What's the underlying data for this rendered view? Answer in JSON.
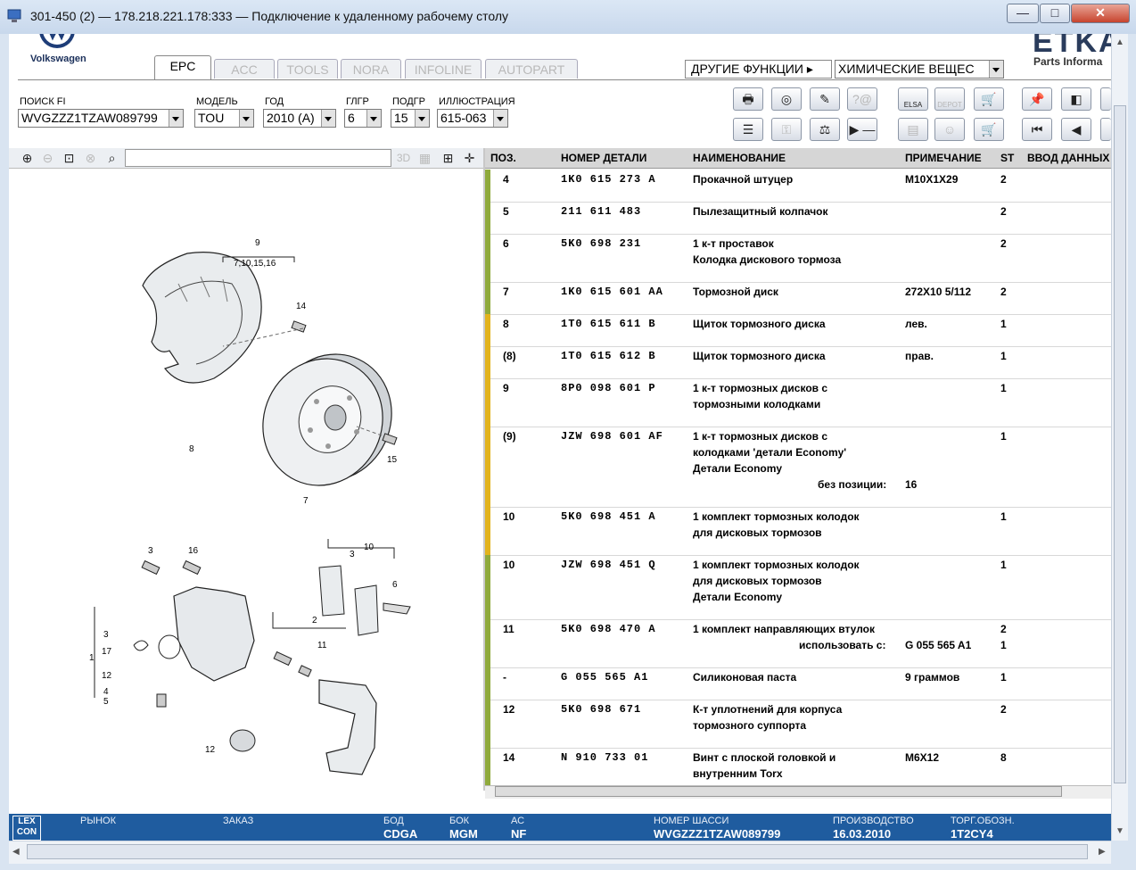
{
  "window": {
    "title": "301-450 (2) — 178.218.221.178:333 — Подключение к удаленному рабочему столу",
    "minimize": "—",
    "maximize": "□",
    "close": "✕"
  },
  "header": {
    "brand": "Volkswagen",
    "etka_logo": "ETKA",
    "etka_sub": "Parts Informa",
    "tabs": [
      "EPC",
      "ACC",
      "TOOLS",
      "NORA",
      "INFOLINE",
      "AUTOPART"
    ],
    "other_functions": "ДРУГИЕ ФУНКЦИИ ▸",
    "chem_combo": "ХИМИЧЕСКИЕ ВЕЩЕС"
  },
  "search": {
    "fi_label": "ПОИСК FI",
    "fi_value": "WVGZZZ1TZAW089799",
    "model_label": "МОДЕЛЬ",
    "model_value": "TOU",
    "year_label": "ГОД",
    "year_value": "2010 (A)",
    "group_label": "ГЛГР",
    "group_value": "6",
    "subgroup_label": "ПОДГР",
    "subgroup_value": "15",
    "illustration_label": "ИЛЛЮСТРАЦИЯ",
    "illustration_value": "615-063"
  },
  "toolbar": {
    "elsa": "ELSA",
    "depot": "DEPOT",
    "threed": "3D"
  },
  "table": {
    "headers": {
      "pos": "ПОЗ.",
      "part": "НОМЕР ДЕТАЛИ",
      "name": "НАИМЕНОВАНИЕ",
      "note": "ПРИМЕЧАНИЕ",
      "st": "ST",
      "entry": "ВВОД ДАННЫХ"
    },
    "rows": [
      {
        "pos": "4",
        "part": "1K0  615  273  A",
        "name": [
          "Прокачной штуцер"
        ],
        "note": [
          "M10X1X29"
        ],
        "st": [
          "2"
        ],
        "color": "#8faa3c"
      },
      {
        "pos": "5",
        "part": "211  611  483",
        "name": [
          "Пылезащитный колпачок"
        ],
        "note": [
          ""
        ],
        "st": [
          "2"
        ],
        "color": "#8faa3c"
      },
      {
        "pos": "6",
        "part": "5K0  698  231",
        "name": [
          "1 к-т проставок",
          "Колодка дискового тормоза"
        ],
        "note": [
          ""
        ],
        "st": [
          "2"
        ],
        "color": "#8faa3c"
      },
      {
        "pos": "7",
        "part": "1K0  615  601  AA",
        "name": [
          "Тормозной диск"
        ],
        "note": [
          "272X10   5/112"
        ],
        "st": [
          "2"
        ],
        "color": "#8faa3c"
      },
      {
        "pos": "8",
        "part": "1T0  615  611  B",
        "name": [
          "Щиток тормозного диска"
        ],
        "note": [
          "лев."
        ],
        "st": [
          "1"
        ],
        "color": "#e2b31d"
      },
      {
        "pos": "(8)",
        "part": "1T0  615  612  B",
        "name": [
          "Щиток тормозного диска"
        ],
        "note": [
          "прав."
        ],
        "st": [
          "1"
        ],
        "color": "#e2b31d"
      },
      {
        "pos": "9",
        "part": "8P0  098  601  P",
        "name": [
          "1 к-т тормозных дисков с",
          "тормозными колодками"
        ],
        "note": [
          ""
        ],
        "st": [
          "1"
        ],
        "color": "#e2b31d"
      },
      {
        "pos": "(9)",
        "part": "JZW  698  601  AF",
        "name": [
          "1 к-т тормозных дисков с",
          "колодками    'детали Economy'",
          "Детали Economy"
        ],
        "note": [
          ""
        ],
        "st": [
          "1"
        ],
        "extra_label": "без позиции:",
        "extra_value": "16",
        "color": "#e2b31d"
      },
      {
        "pos": "10",
        "part": "5K0  698  451  A",
        "name": [
          "1 комплект тормозных колодок",
          "для дисковых тормозов"
        ],
        "note": [
          ""
        ],
        "st": [
          "1"
        ],
        "color": "#e2b31d"
      },
      {
        "pos": "10",
        "part": "JZW  698  451  Q",
        "name": [
          "1 комплект тормозных колодок",
          "для дисковых тормозов",
          "Детали Economy"
        ],
        "note": [
          ""
        ],
        "st": [
          "1"
        ],
        "color": "#8faa3c"
      },
      {
        "pos": "11",
        "part": "5K0  698  470  A",
        "name": [
          "1 комплект направляющих втулок"
        ],
        "note": [
          "",
          "G   055 565 A1"
        ],
        "st": [
          "2",
          "1"
        ],
        "use_label": "использовать с:",
        "color": "#8faa3c"
      },
      {
        "pos": "-",
        "part": "G    055  565  A1",
        "name": [
          "Силиконовая паста"
        ],
        "note": [
          "9 граммов"
        ],
        "st": [
          "1"
        ],
        "color": "#8faa3c"
      },
      {
        "pos": "12",
        "part": "5K0  698  671",
        "name": [
          "К-т уплотнений для корпуса",
          "тормозного суппорта"
        ],
        "note": [
          ""
        ],
        "st": [
          "2"
        ],
        "color": "#8faa3c"
      },
      {
        "pos": "14",
        "part": "N    910  733  01",
        "name": [
          "Винт с плоской головкой и",
          "внутренним Torx"
        ],
        "note": [
          "M6X12"
        ],
        "st": [
          "8"
        ],
        "color": "#8faa3c"
      }
    ]
  },
  "illustration_callouts": {
    "top": [
      "9",
      "7,10,15,16",
      "14",
      "8",
      "7",
      "15"
    ],
    "bottom": [
      "3",
      "16",
      "10",
      "3",
      "6",
      "2",
      "11",
      "3",
      "17",
      "12",
      "4",
      "5",
      "1",
      "12"
    ]
  },
  "status": {
    "logo_top": "LEX",
    "logo_bottom": "CON",
    "market_label": "РЫНОК",
    "market_value": "",
    "order_label": "ЗАКАЗ",
    "order_value": "",
    "bod_label": "БОД",
    "bod_value": "CDGA",
    "bok_label": "БОК",
    "bok_value": "MGM",
    "ac_label": "АС",
    "ac_value": "NF",
    "vin_label": "НОМЕР ШАССИ",
    "vin_value": "WVGZZZ1TZAW089799",
    "prod_label": "ПРОИЗВОДСТВО",
    "prod_value": "16.03.2010",
    "trade_label": "ТОРГ.ОБОЗН.",
    "trade_value": "1T2CY4"
  }
}
